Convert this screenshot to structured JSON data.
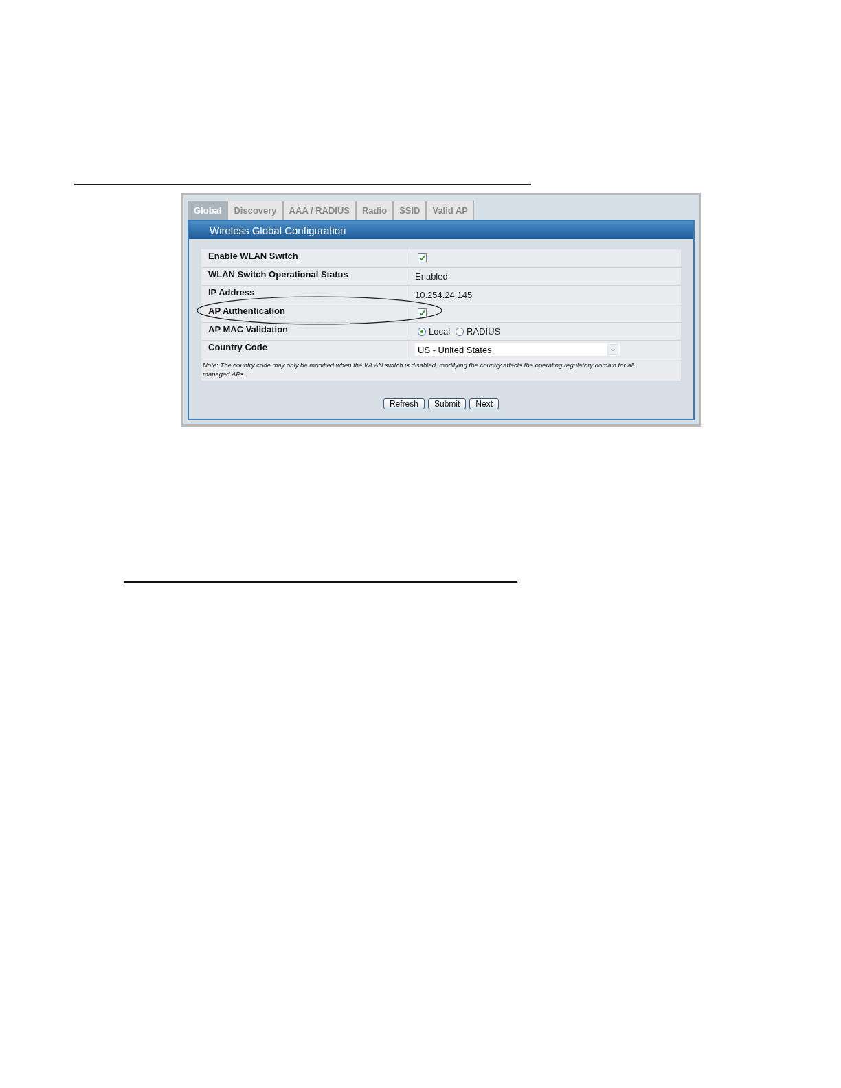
{
  "tabs": [
    {
      "label": "Global",
      "selected": true
    },
    {
      "label": "Discovery",
      "selected": false
    },
    {
      "label": "AAA / RADIUS",
      "selected": false
    },
    {
      "label": "Radio",
      "selected": false
    },
    {
      "label": "SSID",
      "selected": false
    },
    {
      "label": "Valid AP",
      "selected": false
    }
  ],
  "panel": {
    "title": "Wireless Global Configuration"
  },
  "rows": [
    {
      "kind": "checkbox",
      "label": "Enable WLAN Switch",
      "checked": true,
      "annotated": false
    },
    {
      "kind": "text",
      "label": "WLAN Switch Operational Status",
      "value": "Enabled",
      "annotated": false
    },
    {
      "kind": "text",
      "label": "IP Address",
      "value": "10.254.24.145",
      "annotated": false
    },
    {
      "kind": "checkbox",
      "label": "AP Authentication",
      "checked": true,
      "annotated": true
    },
    {
      "kind": "radio",
      "label": "AP MAC Validation",
      "options": [
        {
          "label": "Local",
          "selected": true
        },
        {
          "label": "RADIUS",
          "selected": false
        }
      ],
      "annotated": false
    },
    {
      "kind": "select",
      "label": "Country Code",
      "value": "US - United States",
      "annotated": false
    }
  ],
  "note": "Note: The country code may only be modified when the WLAN switch is disabled, modifying the country affects the operating regulatory domain for all managed APs.",
  "buttons": [
    "Refresh",
    "Submit",
    "Next"
  ]
}
